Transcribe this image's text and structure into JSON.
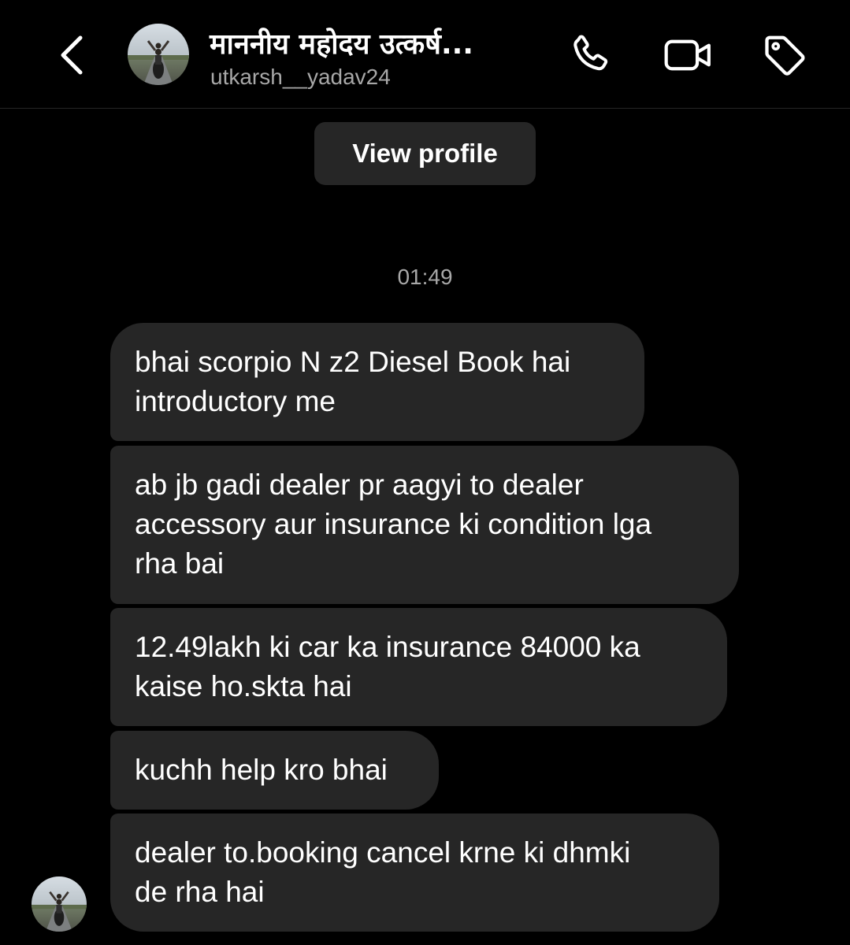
{
  "header": {
    "contact_name": "माननीय महोदय उत्कर्ष...",
    "username": "utkarsh__yadav24",
    "icons": [
      "chevron-left-icon",
      "phone-icon",
      "video-camera-icon",
      "tag-icon"
    ]
  },
  "profile_button": {
    "label": "View profile"
  },
  "chat": {
    "timestamp": "01:49",
    "messages": [
      {
        "text": "bhai scorpio N z2 Diesel Book hai\nintroductory me"
      },
      {
        "text": "ab jb gadi dealer pr aagyi to dealer\naccessory aur insurance ki condition lga\nrha bai"
      },
      {
        "text": "12.49lakh ki car ka insurance 84000 ka\nkaise ho.skta hai"
      },
      {
        "text": "kuchh help kro bhai"
      },
      {
        "text": "dealer to.booking cancel krne ki dhmki\nde rha hai"
      }
    ]
  },
  "colors": {
    "background": "#000000",
    "bubble": "#262626",
    "secondary_text": "#a8a8a8",
    "text": "#ffffff"
  }
}
